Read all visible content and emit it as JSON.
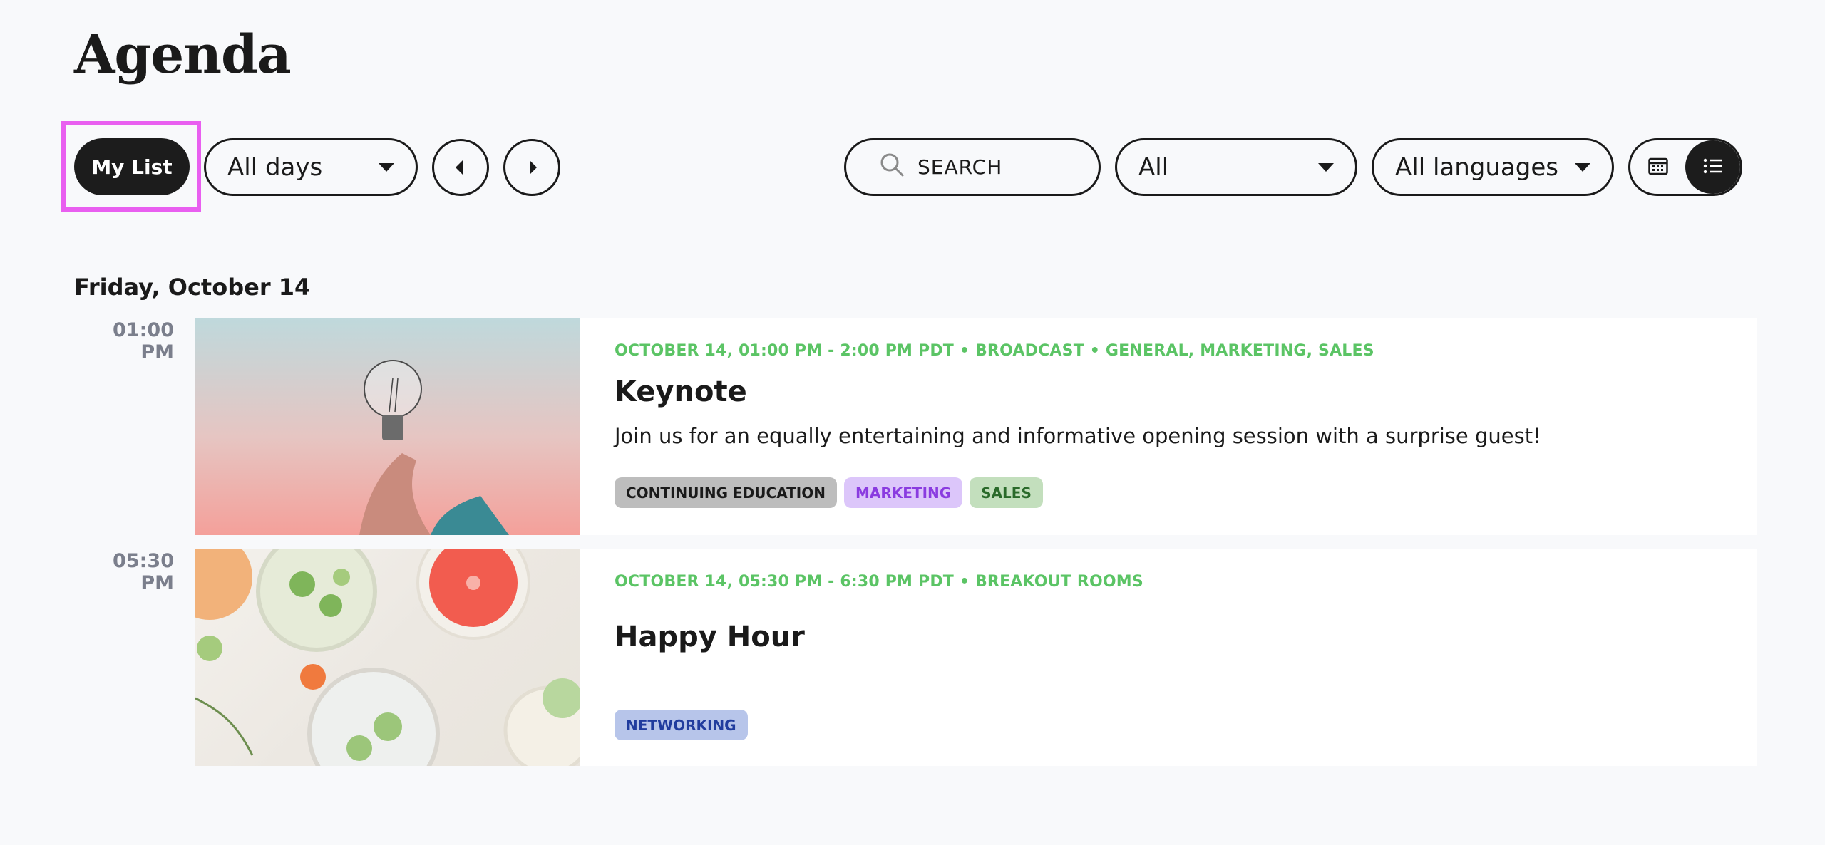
{
  "page": {
    "title": "Agenda"
  },
  "toolbar": {
    "my_list_label": "My List",
    "days_select": "All days",
    "search_placeholder": "SEARCH",
    "category_select": "All",
    "language_select": "All languages"
  },
  "schedule": {
    "date_heading": "Friday, October 14",
    "sessions": [
      {
        "time": "01:00 PM",
        "meta": "OCTOBER 14, 01:00 PM - 2:00 PM PDT • BROADCAST • GENERAL, MARKETING, SALES",
        "title": "Keynote",
        "description": "Join us for an equally entertaining and informative opening session with a surprise guest!",
        "tags": [
          "CONTINUING EDUCATION",
          "MARKETING",
          "SALES"
        ]
      },
      {
        "time": "05:30 PM",
        "meta": "OCTOBER 14, 05:30 PM - 6:30 PM PDT • BREAKOUT ROOMS",
        "title": "Happy Hour",
        "description": "",
        "tags": [
          "NETWORKING"
        ]
      }
    ]
  },
  "icons": {
    "search": "search-icon",
    "calendar": "calendar-icon",
    "list": "list-icon",
    "prev": "chevron-left-icon",
    "next": "chevron-right-icon",
    "caret": "caret-down-icon"
  },
  "colors": {
    "accent_meta": "#5bc465",
    "highlight": "#e95ff0",
    "dark": "#1c1c1c"
  }
}
